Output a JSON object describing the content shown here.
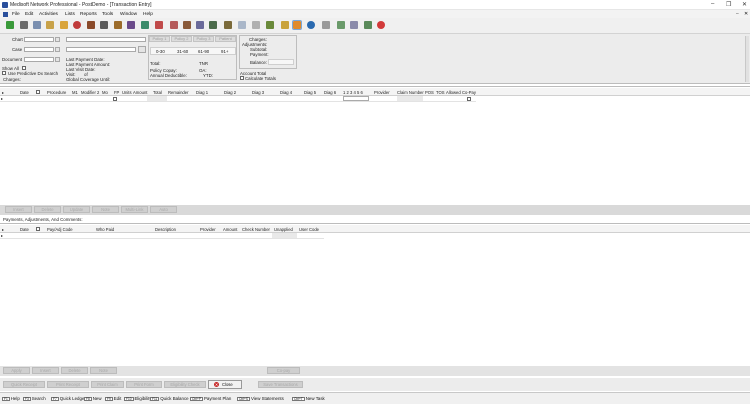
{
  "titlebar": {
    "title": "Medisoft Network Professional - PostDemo - [Transaction Entry]",
    "minimize": "–",
    "restore": "❐",
    "close": "✕"
  },
  "menubar": {
    "items": [
      "File",
      "Edit",
      "Activities",
      "Lists",
      "Reports",
      "Tools",
      "Window",
      "Help"
    ]
  },
  "toolbar": {
    "icons": [
      "new-icon",
      "save-icon",
      "print-icon",
      "open-icon",
      "patient-icon",
      "case-icon",
      "transaction-icon",
      "claim-icon",
      "statement-icon",
      "report-icon",
      "chart-icon",
      "calendar-icon",
      "provider-icon",
      "deposit-icon",
      "payment-icon",
      "letter-icon",
      "notes-icon",
      "scan-icon",
      "edit-icon",
      "copy-icon",
      "lock-icon",
      "bag-icon",
      "active-window-icon",
      "help-icon",
      "question-icon",
      "tool-icon",
      "settings-icon",
      "user-icon",
      "exit-icon"
    ]
  },
  "header": {
    "chart_label": "Chart",
    "case_label": "Case",
    "document_label": "Document",
    "show_all_label": "Show All",
    "predictive_label": "Use Predictive Dx Search",
    "charges_label": "Charges:",
    "last_payment_date": "Last Payment Date:",
    "last_payment_amount": "Last Payment Amount:",
    "last_visit_date": "Last Visit Date:",
    "visit_label": "Visit:",
    "visit_of": "of",
    "global_coverage": "Global Coverage Until:",
    "policy_tabs": [
      "Policy 1",
      "Policy 2",
      "Policy 3",
      "Patient"
    ],
    "aging": [
      "0-30",
      "31-60",
      "61-90",
      "91+"
    ],
    "total_label": "Total:",
    "total_value": "TNR",
    "policy_copay": "Policy Copay:",
    "policy_copay_value": "OA:",
    "annual_deductible": "Annual Deductible:",
    "ytd": "YTD:",
    "summary": {
      "charges": "Charges:",
      "adjustments": "Adjustments:",
      "subtotal": "Subtotal:",
      "payment": "Payment:",
      "balance": "Balance:"
    },
    "account_total": "Account Total",
    "calculate_totals": "Calculate Totals"
  },
  "charges_grid": {
    "columns": [
      "Date",
      "Procedure",
      "M1",
      "Modifier 2",
      "Mo",
      "FP",
      "Units",
      "Amount",
      "Total",
      "Remainder",
      "Diag 1",
      "Diag 2",
      "Diag 3",
      "Diag 4",
      "Diag 5",
      "Diag 6",
      "1 2 3 4 5 6",
      "Provider",
      "Claim Number",
      "POS",
      "TOS",
      "Allowed",
      "Co-Pay"
    ]
  },
  "charges_buttons": [
    "Insert",
    "Delete",
    "Update",
    "Note",
    "Multi-Link",
    "Auto"
  ],
  "payments_section": {
    "title": "Payments, Adjustments, And Comments:",
    "columns": [
      "Date",
      "Pay/Adj Code",
      "Who Paid",
      "Description",
      "Provider",
      "Amount",
      "Check Number",
      "Unapplied",
      "User Code"
    ]
  },
  "payments_buttons": [
    "Apply",
    "Insert",
    "Delete",
    "Note"
  ],
  "payments_right_button": "Co-pay",
  "bottom_buttons": [
    "Quick Receipt",
    "Print Receipt",
    "Print Claim",
    "Print Form",
    "Eligibility Check"
  ],
  "close_button": "Close",
  "save_button": "Save Transactions",
  "statusbar": [
    {
      "key": "F1",
      "label": "Help"
    },
    {
      "key": "F3",
      "label": "Search"
    },
    {
      "key": "F7",
      "label": "Quick Ledger"
    },
    {
      "key": "F8",
      "label": "New"
    },
    {
      "key": "F9",
      "label": "Edit"
    },
    {
      "key": "F10",
      "label": "Eligibility"
    },
    {
      "key": "F11",
      "label": "Quick Balance"
    },
    {
      "key": "Ctrl+P",
      "label": "Payment Plan"
    },
    {
      "key": "Ctrl+S",
      "label": "View Statements"
    },
    {
      "key": "Ctrl+T",
      "label": "New Task"
    }
  ]
}
